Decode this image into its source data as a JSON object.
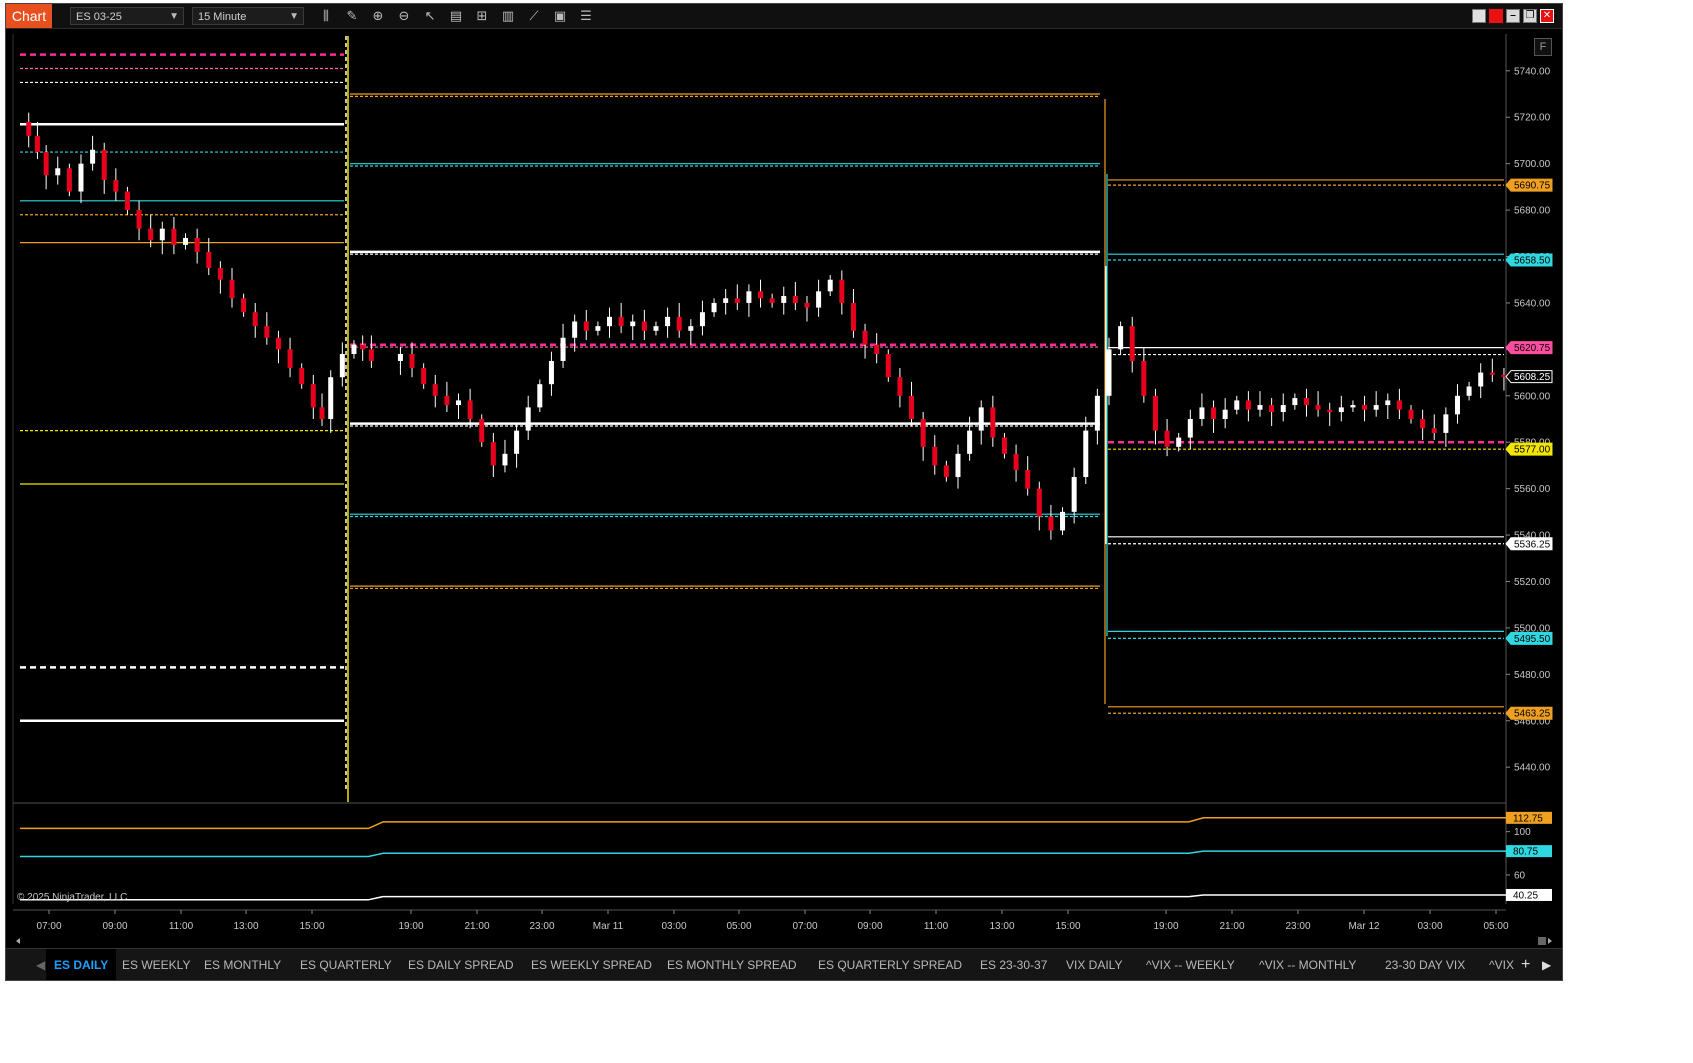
{
  "app": {
    "tab_label": "Chart",
    "copyright": "© 2025 NinjaTrader, LLC",
    "f_button": "F"
  },
  "toolbar": {
    "instrument": "ES 03-25",
    "interval": "15 Minute"
  },
  "tools": [
    {
      "name": "bars-type-icon",
      "glyph": "⫼"
    },
    {
      "name": "drawing-tools-icon",
      "glyph": "✎"
    },
    {
      "name": "zoom-in-icon",
      "glyph": "⊕"
    },
    {
      "name": "zoom-out-icon",
      "glyph": "⊖"
    },
    {
      "name": "pointer-icon",
      "glyph": "↖"
    },
    {
      "name": "data-box-icon",
      "glyph": "▤"
    },
    {
      "name": "chart-trader-icon",
      "glyph": "⊞"
    },
    {
      "name": "indicators-icon",
      "glyph": "▥"
    },
    {
      "name": "strategies-icon",
      "glyph": "⟋"
    },
    {
      "name": "templates-icon",
      "glyph": "▣"
    },
    {
      "name": "properties-icon",
      "glyph": "☰"
    }
  ],
  "price_axis": {
    "min": 5425,
    "max": 5755,
    "ticks": [
      "5740.00",
      "5720.00",
      "5700.00",
      "5680.00",
      "5660.00",
      "5640.00",
      "5620.00",
      "5600.00",
      "5580.00",
      "5560.00",
      "5540.00",
      "5520.00",
      "5500.00",
      "5480.00",
      "5460.00",
      "5440.00"
    ],
    "labels": [
      {
        "text": "5690.75",
        "value": 5690.75,
        "color": "#f0a020"
      },
      {
        "text": "5658.50",
        "value": 5658.5,
        "color": "#2fd8e0"
      },
      {
        "text": "5620.75",
        "value": 5620.75,
        "color": "#ff4ea0"
      },
      {
        "text": "5608.25",
        "value": 5608.25,
        "color": "#000000"
      },
      {
        "text": "5577.00",
        "value": 5577.0,
        "color": "#f2e600"
      },
      {
        "text": "5536.25",
        "value": 5536.25,
        "color": "#ffffff"
      },
      {
        "text": "5495.50",
        "value": 5495.5,
        "color": "#2fd8e0"
      },
      {
        "text": "5463.25",
        "value": 5463.25,
        "color": "#f0a020"
      }
    ]
  },
  "sub_axis": {
    "ticks": [
      "100",
      "60"
    ],
    "labels": [
      {
        "text": "112.75",
        "color": "#f0a020"
      },
      {
        "text": "80.75",
        "color": "#2fd8e0"
      },
      {
        "text": "40.25",
        "color": "#ffffff"
      }
    ]
  },
  "time_axis": {
    "labels": [
      "07:00",
      "09:00",
      "11:00",
      "13:00",
      "15:00",
      "19:00",
      "21:00",
      "23:00",
      "Mar 11",
      "03:00",
      "05:00",
      "07:00",
      "09:00",
      "11:00",
      "13:00",
      "15:00",
      "19:00",
      "21:00",
      "23:00",
      "Mar 12",
      "03:00",
      "05:00"
    ]
  },
  "tabs": [
    "ES DAILY",
    "ES WEEKLY",
    "ES MONTHLY",
    "ES QUARTERLY",
    "ES DAILY SPREAD",
    "ES WEEKLY SPREAD",
    "ES MONTHLY SPREAD",
    "ES QUARTERLY SPREAD",
    "ES 23-30-37",
    "VIX DAILY",
    "^VIX -- WEEKLY",
    "^VIX -- MONTHLY",
    "23-30 DAY VIX",
    "^VIX"
  ],
  "active_tab": 0,
  "chart_data": {
    "type": "candlestick",
    "instrument": "ES 03-25",
    "interval": "15 Minute",
    "x_labels": [
      "07:00",
      "09:00",
      "11:00",
      "13:00",
      "15:00",
      "19:00",
      "21:00",
      "23:00",
      "Mar 11",
      "03:00",
      "05:00",
      "07:00",
      "09:00",
      "11:00",
      "13:00",
      "15:00",
      "19:00",
      "21:00",
      "23:00",
      "Mar 12",
      "03:00",
      "05:00"
    ],
    "ylim": [
      5425,
      5755
    ],
    "level_segments": [
      {
        "session": 1,
        "levels": [
          {
            "price": 5747,
            "color": "#ff2d9a",
            "style": "dash-thick"
          },
          {
            "price": 5741,
            "color": "#ff6bb0",
            "style": "dash"
          },
          {
            "price": 5735,
            "color": "#ffffff",
            "style": "dash"
          },
          {
            "price": 5717,
            "color": "#ffffff",
            "style": "solid-thick"
          },
          {
            "price": 5705,
            "color": "#2fd8e0",
            "style": "dash"
          },
          {
            "price": 5684,
            "color": "#2fd8e0",
            "style": "solid"
          },
          {
            "price": 5678,
            "color": "#f0a020",
            "style": "dash"
          },
          {
            "price": 5666,
            "color": "#f0a020",
            "style": "solid"
          },
          {
            "price": 5585,
            "color": "#f2e600",
            "style": "dash"
          },
          {
            "price": 5562,
            "color": "#f2e600",
            "style": "solid"
          },
          {
            "price": 5483,
            "color": "#ffffff",
            "style": "dash-thick"
          },
          {
            "price": 5460,
            "color": "#ffffff",
            "style": "solid-thick"
          }
        ]
      },
      {
        "session": 2,
        "levels": [
          {
            "price": 5730,
            "color": "#f0a020",
            "style": "solid"
          },
          {
            "price": 5729,
            "color": "#f0a020",
            "style": "dash"
          },
          {
            "price": 5700,
            "color": "#2fd8e0",
            "style": "solid"
          },
          {
            "price": 5699,
            "color": "#2fd8e0",
            "style": "dash"
          },
          {
            "price": 5662,
            "color": "#ffffff",
            "style": "solid-thick"
          },
          {
            "price": 5661,
            "color": "#ffffff",
            "style": "dash"
          },
          {
            "price": 5622,
            "color": "#ff2d9a",
            "style": "dash-thick"
          },
          {
            "price": 5621,
            "color": "#ff6bb0",
            "style": "dash"
          },
          {
            "price": 5588,
            "color": "#ffffff",
            "style": "solid-thick"
          },
          {
            "price": 5587,
            "color": "#ffffff",
            "style": "dash"
          },
          {
            "price": 5549,
            "color": "#2fd8e0",
            "style": "solid"
          },
          {
            "price": 5548,
            "color": "#2fd8e0",
            "style": "dash"
          },
          {
            "price": 5518,
            "color": "#f0a020",
            "style": "solid"
          },
          {
            "price": 5517,
            "color": "#f0a020",
            "style": "dash"
          }
        ]
      },
      {
        "session": 3,
        "levels": [
          {
            "price": 5693,
            "color": "#f0a020",
            "style": "solid"
          },
          {
            "price": 5690.75,
            "color": "#f0a020",
            "style": "dash"
          },
          {
            "price": 5661,
            "color": "#2fd8e0",
            "style": "solid"
          },
          {
            "price": 5658.5,
            "color": "#2fd8e0",
            "style": "dash"
          },
          {
            "price": 5620.75,
            "color": "#ffffff",
            "style": "solid"
          },
          {
            "price": 5617.75,
            "color": "#ffffff",
            "style": "dash"
          },
          {
            "price": 5580,
            "color": "#ff2d9a",
            "style": "dash-thick"
          },
          {
            "price": 5577,
            "color": "#f2e600",
            "style": "dash"
          },
          {
            "price": 5539.25,
            "color": "#ffffff",
            "style": "solid"
          },
          {
            "price": 5536.25,
            "color": "#ffffff",
            "style": "dash"
          },
          {
            "price": 5498.5,
            "color": "#2fd8e0",
            "style": "solid"
          },
          {
            "price": 5495.5,
            "color": "#2fd8e0",
            "style": "dash"
          },
          {
            "price": 5466,
            "color": "#f0a020",
            "style": "solid"
          },
          {
            "price": 5463.25,
            "color": "#f0a020",
            "style": "dash"
          }
        ]
      }
    ],
    "price_path": [
      [
        0,
        5710
      ],
      [
        0.006,
        5718
      ],
      [
        0.012,
        5712
      ],
      [
        0.018,
        5705
      ],
      [
        0.026,
        5695
      ],
      [
        0.034,
        5698
      ],
      [
        0.042,
        5688
      ],
      [
        0.05,
        5700
      ],
      [
        0.058,
        5706
      ],
      [
        0.066,
        5693
      ],
      [
        0.074,
        5688
      ],
      [
        0.082,
        5680
      ],
      [
        0.09,
        5672
      ],
      [
        0.098,
        5667
      ],
      [
        0.106,
        5672
      ],
      [
        0.114,
        5665
      ],
      [
        0.122,
        5668
      ],
      [
        0.13,
        5662
      ],
      [
        0.138,
        5655
      ],
      [
        0.146,
        5650
      ],
      [
        0.154,
        5642
      ],
      [
        0.162,
        5636
      ],
      [
        0.17,
        5630
      ],
      [
        0.178,
        5625
      ],
      [
        0.186,
        5620
      ],
      [
        0.194,
        5612
      ],
      [
        0.202,
        5605
      ],
      [
        0.208,
        5595
      ],
      [
        0.214,
        5590
      ],
      [
        0.222,
        5608
      ],
      [
        0.23,
        5618
      ],
      [
        0.236,
        5622
      ],
      [
        0.242,
        5620
      ],
      [
        0.262,
        5615
      ],
      [
        0.27,
        5618
      ],
      [
        0.278,
        5612
      ],
      [
        0.286,
        5605
      ],
      [
        0.294,
        5600
      ],
      [
        0.302,
        5596
      ],
      [
        0.31,
        5598
      ],
      [
        0.318,
        5590
      ],
      [
        0.326,
        5580
      ],
      [
        0.334,
        5570
      ],
      [
        0.342,
        5575
      ],
      [
        0.35,
        5585
      ],
      [
        0.358,
        5595
      ],
      [
        0.366,
        5605
      ],
      [
        0.374,
        5615
      ],
      [
        0.382,
        5625
      ],
      [
        0.39,
        5632
      ],
      [
        0.398,
        5628
      ],
      [
        0.406,
        5630
      ],
      [
        0.414,
        5634
      ],
      [
        0.422,
        5630
      ],
      [
        0.43,
        5632
      ],
      [
        0.438,
        5628
      ],
      [
        0.446,
        5630
      ],
      [
        0.454,
        5634
      ],
      [
        0.462,
        5628
      ],
      [
        0.47,
        5630
      ],
      [
        0.478,
        5636
      ],
      [
        0.486,
        5640
      ],
      [
        0.494,
        5642
      ],
      [
        0.502,
        5640
      ],
      [
        0.51,
        5645
      ],
      [
        0.518,
        5642
      ],
      [
        0.526,
        5640
      ],
      [
        0.534,
        5643
      ],
      [
        0.542,
        5640
      ],
      [
        0.55,
        5638
      ],
      [
        0.558,
        5645
      ],
      [
        0.566,
        5650
      ],
      [
        0.574,
        5640
      ],
      [
        0.582,
        5628
      ],
      [
        0.59,
        5622
      ],
      [
        0.598,
        5618
      ],
      [
        0.606,
        5608
      ],
      [
        0.614,
        5600
      ],
      [
        0.622,
        5590
      ],
      [
        0.63,
        5578
      ],
      [
        0.638,
        5570
      ],
      [
        0.646,
        5565
      ],
      [
        0.654,
        5575
      ],
      [
        0.662,
        5585
      ],
      [
        0.67,
        5595
      ],
      [
        0.678,
        5582
      ],
      [
        0.686,
        5575
      ],
      [
        0.694,
        5568
      ],
      [
        0.702,
        5560
      ],
      [
        0.71,
        5548
      ],
      [
        0.718,
        5542
      ],
      [
        0.726,
        5550
      ],
      [
        0.734,
        5565
      ],
      [
        0.742,
        5585
      ],
      [
        0.75,
        5600
      ],
      [
        0.758,
        5620
      ],
      [
        0.766,
        5630
      ],
      [
        0.774,
        5615
      ],
      [
        0.782,
        5600
      ],
      [
        0.79,
        5585
      ],
      [
        0.798,
        5578
      ],
      [
        0.806,
        5582
      ],
      [
        0.814,
        5590
      ],
      [
        0.822,
        5595
      ],
      [
        0.83,
        5590
      ],
      [
        0.838,
        5594
      ],
      [
        0.846,
        5598
      ],
      [
        0.854,
        5594
      ],
      [
        0.862,
        5596
      ],
      [
        0.87,
        5593
      ],
      [
        0.878,
        5596
      ],
      [
        0.886,
        5599
      ],
      [
        0.894,
        5596
      ],
      [
        0.902,
        5594
      ],
      [
        0.91,
        5593
      ],
      [
        0.918,
        5595
      ],
      [
        0.926,
        5596
      ],
      [
        0.934,
        5594
      ],
      [
        0.942,
        5596
      ],
      [
        0.95,
        5598
      ],
      [
        0.958,
        5594
      ],
      [
        0.966,
        5590
      ],
      [
        0.974,
        5586
      ],
      [
        0.982,
        5584
      ],
      [
        0.99,
        5592
      ],
      [
        0.998,
        5600
      ],
      [
        1.006,
        5604
      ],
      [
        1.014,
        5610
      ],
      [
        1.022,
        5609
      ],
      [
        1.03,
        5608.25
      ]
    ],
    "sub_panel": {
      "series": [
        {
          "color": "#f0a020",
          "values": [
            [
              0,
              103
            ],
            [
              0.24,
              103
            ],
            [
              0.25,
              109
            ],
            [
              0.805,
              109
            ],
            [
              0.815,
              112.75
            ],
            [
              1.03,
              112.75
            ]
          ]
        },
        {
          "color": "#2fd8e0",
          "values": [
            [
              0,
              77
            ],
            [
              0.24,
              77
            ],
            [
              0.25,
              80
            ],
            [
              0.805,
              80
            ],
            [
              0.815,
              82
            ],
            [
              1.03,
              82
            ]
          ]
        },
        {
          "color": "#ffffff",
          "values": [
            [
              0,
              37
            ],
            [
              0.24,
              37
            ],
            [
              0.25,
              40
            ],
            [
              0.805,
              40
            ],
            [
              0.815,
              41.5
            ],
            [
              1.03,
              41.5
            ]
          ]
        }
      ],
      "ylim": [
        35,
        120
      ]
    }
  }
}
